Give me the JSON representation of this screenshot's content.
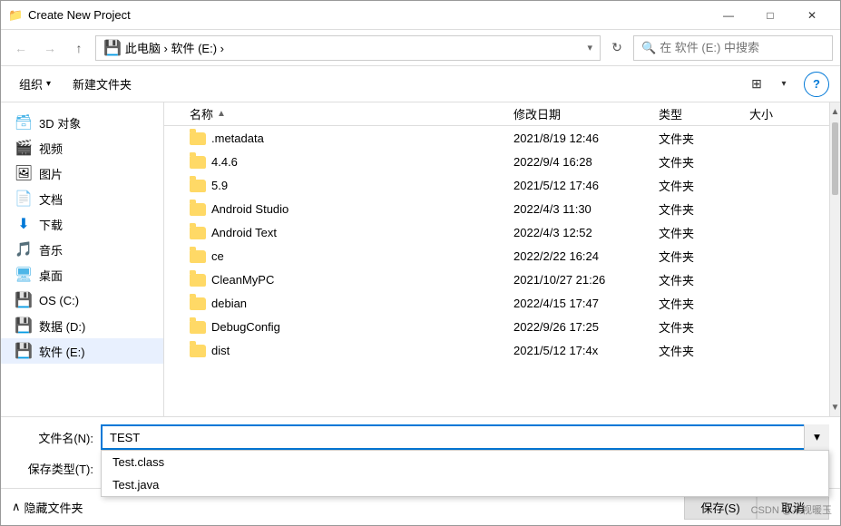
{
  "window": {
    "title": "Create New Project",
    "icon": "📁"
  },
  "titlebar_controls": {
    "minimize": "—",
    "maximize": "□",
    "close": "✕"
  },
  "addressbar": {
    "back": "←",
    "forward": "→",
    "up": "↑",
    "path_parts": [
      "此电脑",
      "软件 (E:)"
    ],
    "path_display": "此电脑  ›  软件 (E:)  ›",
    "refresh": "↻",
    "search_placeholder": "在 软件 (E:) 中搜索"
  },
  "toolbar": {
    "organize_label": "组织",
    "new_folder_label": "新建文件夹",
    "view_icon": "⊞",
    "chevron": "▾",
    "help": "?"
  },
  "sidebar": {
    "items": [
      {
        "id": "3d",
        "label": "3D 对象",
        "icon_color": "#4db6e8",
        "unicode": "🗃"
      },
      {
        "id": "video",
        "label": "视频",
        "icon_color": "#555",
        "unicode": "🎬"
      },
      {
        "id": "pictures",
        "label": "图片",
        "icon_color": "#555",
        "unicode": "🖼"
      },
      {
        "id": "documents",
        "label": "文档",
        "icon_color": "#555",
        "unicode": "📄"
      },
      {
        "id": "downloads",
        "label": "下载",
        "icon_color": "#0078d7",
        "unicode": "⬇"
      },
      {
        "id": "music",
        "label": "音乐",
        "icon_color": "#0078d7",
        "unicode": "🎵"
      },
      {
        "id": "desktop",
        "label": "桌面",
        "icon_color": "#4db6e8",
        "unicode": "🖥"
      },
      {
        "id": "osdrive",
        "label": "OS (C:)",
        "icon_color": "#555",
        "unicode": "💾"
      },
      {
        "id": "datadrive",
        "label": "数据 (D:)",
        "icon_color": "#555",
        "unicode": "💾"
      },
      {
        "id": "softwaredrive",
        "label": "软件 (E:)",
        "icon_color": "#555",
        "unicode": "💾"
      }
    ]
  },
  "file_list": {
    "headers": {
      "name": "名称",
      "date": "修改日期",
      "type": "类型",
      "size": "大小"
    },
    "files": [
      {
        "name": ".metadata",
        "date": "2021/8/19 12:46",
        "type": "文件夹",
        "size": ""
      },
      {
        "name": "4.4.6",
        "date": "2022/9/4 16:28",
        "type": "文件夹",
        "size": ""
      },
      {
        "name": "5.9",
        "date": "2021/5/12 17:46",
        "type": "文件夹",
        "size": ""
      },
      {
        "name": "Android Studio",
        "date": "2022/4/3 11:30",
        "type": "文件夹",
        "size": ""
      },
      {
        "name": "Android Text",
        "date": "2022/4/3 12:52",
        "type": "文件夹",
        "size": ""
      },
      {
        "name": "ce",
        "date": "2022/2/22 16:24",
        "type": "文件夹",
        "size": ""
      },
      {
        "name": "CleanMyPC",
        "date": "2021/10/27 21:26",
        "type": "文件夹",
        "size": ""
      },
      {
        "name": "debian",
        "date": "2022/4/15 17:47",
        "type": "文件夹",
        "size": ""
      },
      {
        "name": "DebugConfig",
        "date": "2022/9/26 17:25",
        "type": "文件夹",
        "size": ""
      },
      {
        "name": "dist",
        "date": "2021/5/12 17:4x",
        "type": "文件夹",
        "size": ""
      }
    ]
  },
  "filename_field": {
    "label": "文件名(N):",
    "value": "TEST",
    "autocomplete": [
      "Test.class",
      "Test.java"
    ]
  },
  "filetype_field": {
    "label": "保存类型(T):",
    "value": ""
  },
  "hidden_files": {
    "label": "隐藏文件夹",
    "toggle_icon": "∧"
  },
  "buttons": {
    "save": "保存(S)",
    "cancel": "取消"
  },
  "watermark": "CSDN @某视暖玉"
}
